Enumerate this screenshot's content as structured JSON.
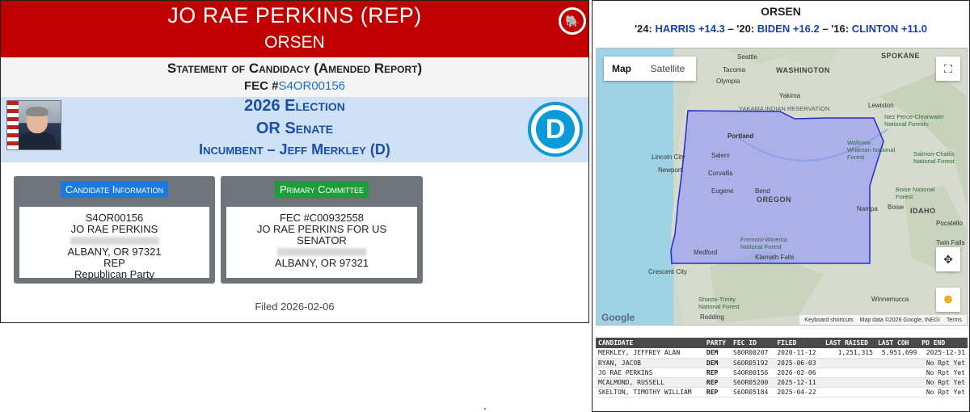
{
  "candidate": {
    "header_name": "JO RAE PERKINS (REP)",
    "header_subtitle": "ORSEN",
    "statement_title": "Statement of Candidacy (Amended Report)",
    "fec_prefix": "FEC #",
    "fec_id": "S4OR00156"
  },
  "election": {
    "year_line": "2026 Election",
    "race_line": "OR Senate",
    "incumbent_line": "Incumbent – Jeff Merkley (D)"
  },
  "candidate_info": {
    "heading": "Candidate Information",
    "lines": [
      "S4OR00156",
      "JO RAE PERKINS",
      "",
      "ALBANY, OR 97321",
      "REP",
      "Republican Party"
    ]
  },
  "primary_committee": {
    "heading": "Primary Committee",
    "lines": [
      "FEC #C00932558",
      "JO RAE PERKINS FOR US",
      "SENATOR",
      "",
      "ALBANY, OR 97321"
    ]
  },
  "filed_text": "Filed 2026-02-06",
  "right_panel": {
    "title": "ORSEN",
    "margins": {
      "p24": "'24:",
      "v24": "HARRIS +14.3",
      "p20": " – '20:",
      "v20": "BIDEN +16.2",
      "p16": " – '16:",
      "v16": "CLINTON +11.0"
    }
  },
  "map": {
    "tab_map": "Map",
    "tab_satellite": "Satellite",
    "google": "Google",
    "attrib_shortcuts": "Keyboard shortcuts",
    "attrib_data": "Map data ©2026 Google, INEGI",
    "attrib_terms": "Terms",
    "labels": {
      "seattle": "Seattle",
      "tacoma": "Tacoma",
      "olympia": "Olympia",
      "washington": "WASHINGTON",
      "spokane": "SPOKANE",
      "yakima": "Yakima",
      "yakama": "YAKAMA INDIAN RESERVATION",
      "lewiston": "Lewiston",
      "nez_perce": "Nez Perce-Clearwater National Forests",
      "portland": "Portland",
      "salem": "Salem",
      "lincoln": "Lincoln City",
      "newport": "Newport",
      "corvallis": "Corvallis",
      "eugene": "Eugene",
      "bend": "Bend",
      "oregon": "OREGON",
      "wallowa": "Wallowa-Whitman National Forest",
      "salmon": "Salmon-Challis National Forest",
      "boise_nf": "Boise National Forest",
      "boise": "Boise",
      "nampa": "Nampa",
      "idaho": "IDAHO",
      "fremont": "Fremont-Winema National Forest",
      "klamath": "Klamath Falls",
      "medford": "Medford",
      "crescent": "Crescent City",
      "redding": "Redding",
      "shasta": "Shasta-Trinity National Forest",
      "winnemucca": "Winnemucca",
      "twin_falls": "Twin Falls",
      "pocatello": "Pocatello"
    }
  },
  "candidates_table": {
    "headers": [
      "CANDIDATE",
      "PARTY",
      "FEC ID",
      "FILED",
      "LAST RAISED",
      "LAST COH",
      "PD END"
    ],
    "rows": [
      [
        "MERKLEY, JEFFREY ALAN",
        "DEM",
        "S8OR00207",
        "2020-11-12",
        "1,251,315",
        "5,951,699",
        "2025-12-31"
      ],
      [
        "RYAN, JACOB",
        "DEM",
        "S6OR05192",
        "2025-06-03",
        "",
        "",
        "No Rpt Yet"
      ],
      [
        "JO RAE PERKINS",
        "REP",
        "S4OR00156",
        "2026-02-06",
        "",
        "",
        "No Rpt Yet"
      ],
      [
        "MCALMOND, RUSSELL",
        "REP",
        "S6OR05200",
        "2025-12-11",
        "",
        "",
        "No Rpt Yet"
      ],
      [
        "SKELTON, TIMOTHY WILLIAM",
        "REP",
        "S6OR05184",
        "2025-04-22",
        "",
        "",
        "No Rpt Yet"
      ]
    ]
  },
  "colors": {
    "rep_red": "#c00000",
    "dem_blue": "#0a9ad8",
    "link_blue": "#1a6fd6",
    "band_blue": "#cfe2f5"
  },
  "icons": [
    "republican-elephant-icon",
    "democrat-d-icon",
    "fullscreen-icon",
    "camera-control-icon",
    "pegman-icon"
  ]
}
